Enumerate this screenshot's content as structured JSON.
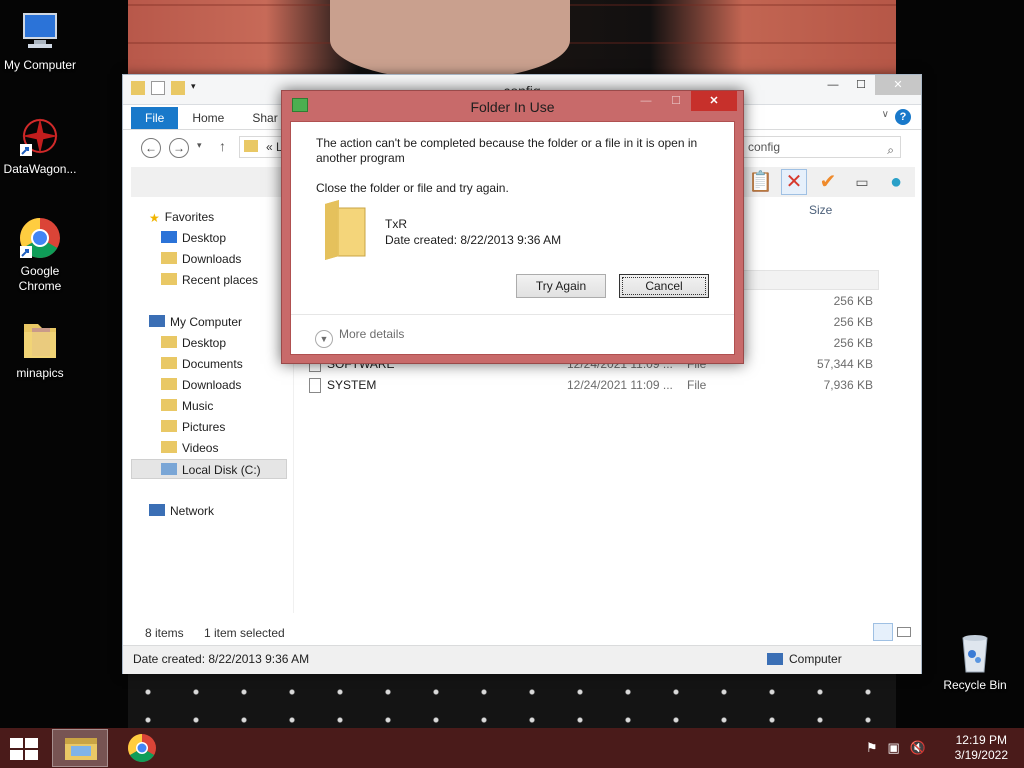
{
  "desktop": {
    "icons": [
      {
        "label": "My Computer",
        "icon": "monitor-icon"
      },
      {
        "label": "DataWagon...",
        "icon": "datawagon-icon"
      },
      {
        "label": "Google Chrome",
        "icon": "chrome-icon"
      },
      {
        "label": "minapics",
        "icon": "folder-icon"
      },
      {
        "label": "Recycle Bin",
        "icon": "recycle-bin-icon"
      }
    ]
  },
  "explorer": {
    "title": "config",
    "tabs": [
      "File",
      "Home",
      "Shar"
    ],
    "address": "« L",
    "search_value": "config",
    "column_size": "Size",
    "nav": {
      "favorites": "Favorites",
      "fav_items": [
        "Desktop",
        "Downloads",
        "Recent places"
      ],
      "computer": "My Computer",
      "comp_items": [
        "Desktop",
        "Documents",
        "Downloads",
        "Music",
        "Pictures",
        "Videos",
        "Local Disk (C:)"
      ],
      "network": "Network"
    },
    "files": [
      {
        "name": "",
        "date": "",
        "type": "",
        "size": "256 KB"
      },
      {
        "name": "",
        "date": "",
        "type": "",
        "size": "256 KB"
      },
      {
        "name": "",
        "date": "",
        "type": "",
        "size": "256 KB"
      },
      {
        "name": "SOFTWARE",
        "date": "12/24/2021 11:09 ...",
        "type": "File",
        "size": "57,344 KB"
      },
      {
        "name": "SYSTEM",
        "date": "12/24/2021 11:09 ...",
        "type": "File",
        "size": "7,936 KB"
      }
    ],
    "status": {
      "items": "8 items",
      "selected": "1 item selected"
    },
    "details": {
      "date_created": "Date created: 8/22/2013 9:36 AM",
      "location": "Computer"
    }
  },
  "dialog": {
    "title": "Folder In Use",
    "message": "The action can't be completed because the folder or a file in it is open in another program",
    "instruction": "Close the folder or file and try again.",
    "item_name": "TxR",
    "item_date": "Date created: 8/22/2013 9:36 AM",
    "try_again": "Try Again",
    "cancel": "Cancel",
    "more_details": "More details"
  },
  "taskbar": {
    "time": "12:19 PM",
    "date": "3/19/2022"
  }
}
